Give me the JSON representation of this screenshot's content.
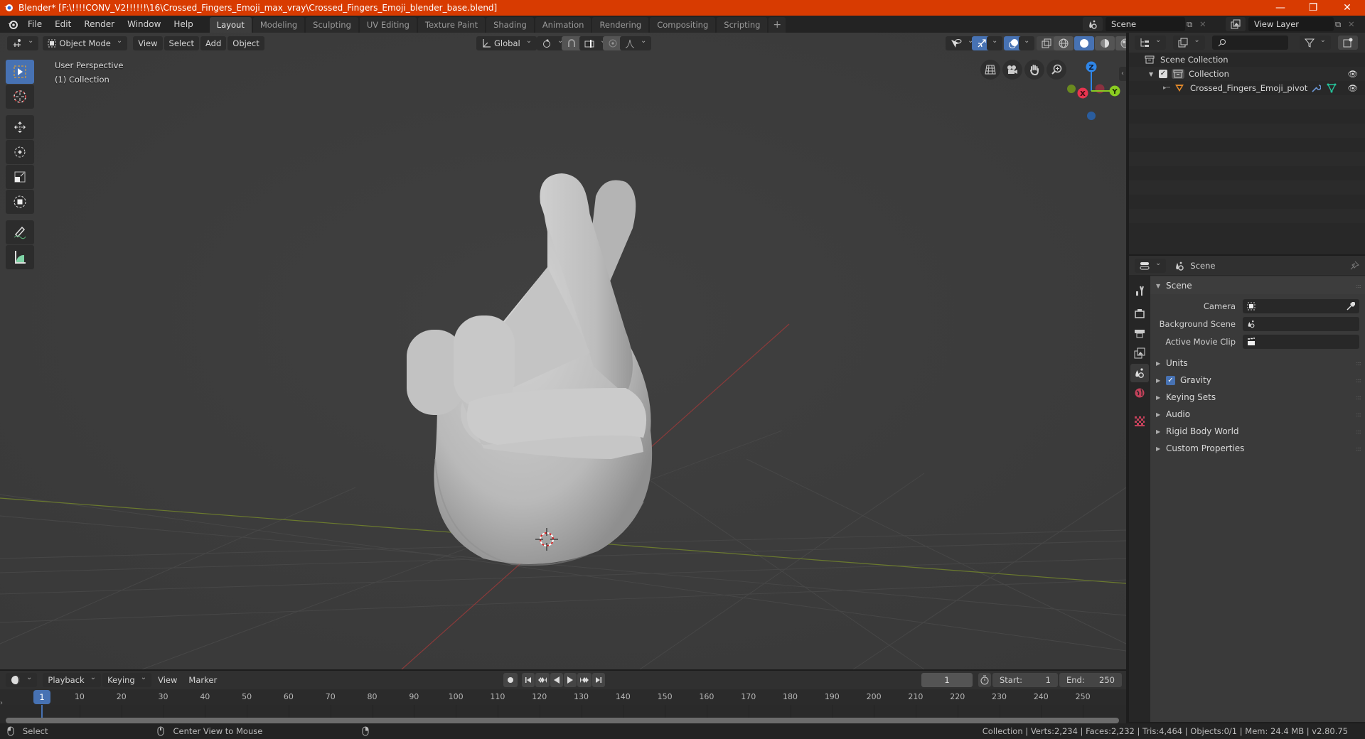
{
  "window": {
    "title": "Blender* [F:\\!!!!CONV_V2!!!!!!\\16\\Crossed_Fingers_Emoji_max_vray\\Crossed_Fingers_Emoji_blender_base.blend]",
    "controls": {
      "minimize": "—",
      "maximize": "❐",
      "close": "✕"
    }
  },
  "menubar": {
    "items": [
      "File",
      "Edit",
      "Render",
      "Window",
      "Help"
    ]
  },
  "workspaces": {
    "tabs": [
      "Layout",
      "Modeling",
      "Sculpting",
      "UV Editing",
      "Texture Paint",
      "Shading",
      "Animation",
      "Rendering",
      "Compositing",
      "Scripting"
    ],
    "active": "Layout",
    "add_label": "+"
  },
  "scene_selector": {
    "value": "Scene"
  },
  "view_layer_selector": {
    "value": "View Layer"
  },
  "viewport": {
    "mode": "Object Mode",
    "menus": [
      "View",
      "Select",
      "Add",
      "Object"
    ],
    "transform_orientation": "Global",
    "overlay_title": "User Perspective",
    "overlay_subtitle": "(1) Collection",
    "gizmo_axes": {
      "x": "X",
      "y": "Y",
      "z": "Z"
    },
    "colors": {
      "x_axis": "#e8344f",
      "y_axis": "#8acc21",
      "z_axis": "#2f86e8",
      "accent": "#4772b3"
    }
  },
  "outliner": {
    "search_placeholder": "",
    "rows": [
      {
        "label": "Scene Collection",
        "level": 0
      },
      {
        "label": "Collection",
        "level": 1,
        "checked": true
      },
      {
        "label": "Crossed_Fingers_Emoji_pivot",
        "level": 2
      }
    ]
  },
  "properties": {
    "context": "Scene",
    "panel_title": "Scene",
    "fields": [
      {
        "label": "Camera",
        "value": ""
      },
      {
        "label": "Background Scene",
        "value": ""
      },
      {
        "label": "Active Movie Clip",
        "value": ""
      }
    ],
    "subpanels": [
      "Units",
      "Gravity",
      "Keying Sets",
      "Audio",
      "Rigid Body World",
      "Custom Properties"
    ],
    "gravity_enabled": true
  },
  "timeline": {
    "menus": [
      "Playback",
      "Keying",
      "View",
      "Marker"
    ],
    "current_frame": "1",
    "start_label": "Start:",
    "start": "1",
    "end_label": "End:",
    "end": "250",
    "ruler": [
      "10",
      "20",
      "30",
      "40",
      "50",
      "60",
      "70",
      "80",
      "90",
      "100",
      "110",
      "120",
      "130",
      "140",
      "150",
      "160",
      "170",
      "180",
      "190",
      "200",
      "210",
      "220",
      "230",
      "240",
      "250"
    ],
    "playhead": "1"
  },
  "statusbar": {
    "left_action": "Select",
    "middle_action": "Center View to Mouse",
    "stats": "Collection | Verts:2,234 | Faces:2,232 | Tris:4,464 | Objects:0/1 | Mem: 24.4 MB | v2.80.75"
  }
}
